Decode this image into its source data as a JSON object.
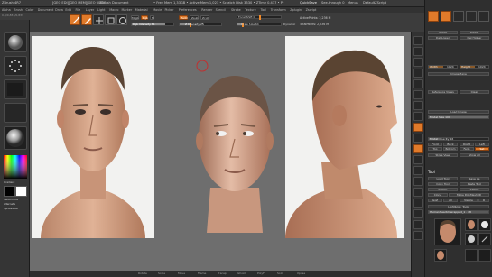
{
  "titlebar": {
    "app": "ZBrush 4R7",
    "items": [
      "[GEO EDI][GEO MEM][GEO UNDO]",
      "ZBrush Document",
      "• Free Mem 1,33GB • Active Mem 1,021 • Scratch Disk 3330 • ZTime 0.437 • Pr",
      "QuickSave",
      "See-through 0",
      "Menus",
      "DefaultZScript",
      "?",
      "M"
    ],
    "coords": "0,0/0,833/0,833"
  },
  "menubar": [
    "Alpha",
    "Brush",
    "Color",
    "Document",
    "Draw",
    "Edit",
    "File",
    "Layer",
    "Light",
    "Macro",
    "Marker",
    "Material",
    "Movie",
    "Picker",
    "Preferences",
    "Render",
    "Stencil",
    "Stroke",
    "Texture",
    "Tool",
    "Transform",
    "Zplugin",
    "Zscript"
  ],
  "toolbar": {
    "mrgb": "Mrgb",
    "rgb": "Rgb",
    "m": "M",
    "zadd": "Zadd",
    "zsub": "Zsub",
    "zcut": "Zcut",
    "focal_shift": "Focal Shift 0",
    "active_points": "ActivePoints: 2,236 M",
    "rgb_intensity": "Rgb Intensity 81",
    "z_intensity": "Z Intensity 25",
    "draw_size": "Draw Size 64",
    "dynamic": "Dynamic",
    "total_points": "TotalPoints: 2,236 M",
    "projection": "Projection Master",
    "lightbox": "LightBox"
  },
  "leftshelf": {
    "gradient": "Gradient",
    "switch_color": "SwitchColor",
    "alternate": "Alternate",
    "spix_label": "SpixPalette"
  },
  "right_panel": {
    "header_buttons": [
      "Sculpt",
      "Divide",
      "Del Lower",
      "Del Higher"
    ],
    "width_label": "Width",
    "width_value": "1024",
    "height_label": "Height",
    "height_value": "1024",
    "image_plane_label": "ImagePlane",
    "ref_views": "Reference Views",
    "clear": "Clear",
    "load_image": "Load Image",
    "model_size": "Model Size 100",
    "model_opacity": "Model Opacity 16",
    "show_rows": [
      [
        "Front",
        "Back",
        "Right",
        "Left"
      ],
      [
        "Top",
        "Bottom",
        "Fade",
        "Set"
      ]
    ],
    "store_view": "Store View",
    "show_all": "Show All",
    "tool_header": "Tool",
    "tool_buttons": [
      [
        "Load Tool",
        "Save As"
      ],
      [
        "Copy Tool",
        "Paste Tool"
      ],
      [
        "Import",
        "Export"
      ],
      [
        "Clone",
        "Make PolyMesh3D"
      ],
      [
        "GoZ",
        "All",
        "Visible",
        "R"
      ]
    ],
    "lightbox_tools": "Lightbox › Tools",
    "current_tool": "HumanHeadUnwrapped_1 · 48",
    "subtools": [
      "HumanHead",
      "Cylinder3D",
      "SimpleBrush"
    ]
  },
  "bottombar": {
    "items": [
      "Rotate",
      "Scale",
      "Move",
      "Frame",
      "Transp",
      "Ghost",
      "PolyF",
      "Solo",
      "Xpose"
    ]
  },
  "colors": {
    "accent": "#e07a2a",
    "canvas": "#6e6e6e",
    "panel": "#2f2f2f"
  },
  "icons": [
    "sphere-brush-icon",
    "dots-stroke-icon",
    "alpha-icon",
    "material-sphere-icon",
    "color-picker-icon",
    "rotate-icon",
    "scale-icon",
    "move-icon",
    "frame-icon"
  ]
}
